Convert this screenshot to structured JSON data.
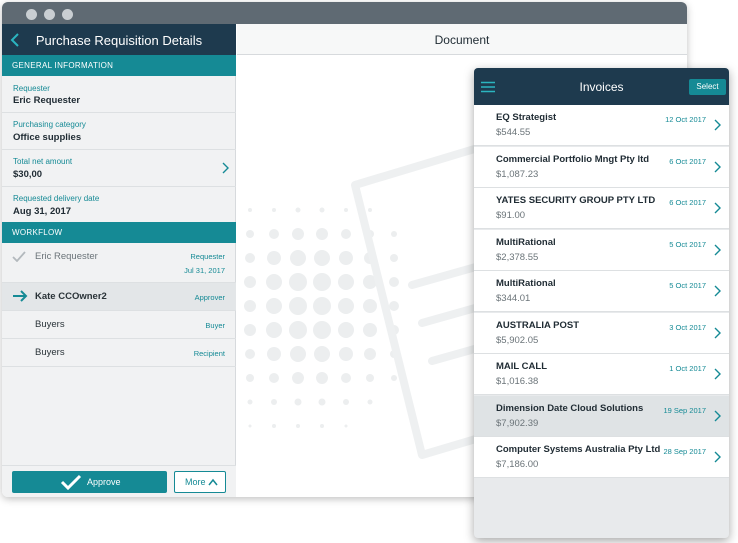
{
  "left_panel": {
    "title": "Purchase Requisition Details",
    "general_section": "General Information",
    "fields": [
      {
        "label": "Requester",
        "value": "Eric Requester"
      },
      {
        "label": "Purchasing category",
        "value": "Office supplies"
      },
      {
        "label": "Total net amount",
        "value": "$30,00"
      },
      {
        "label": "Requested delivery date",
        "value": "Aug 31, 2017"
      }
    ],
    "workflow_section": "Workflow",
    "workflow": [
      {
        "name": "Eric Requester",
        "role": "Requester",
        "date": "Jul 31, 2017",
        "status": "done"
      },
      {
        "name": "Kate CCOwner2",
        "role": "Approver",
        "status": "current"
      },
      {
        "name": "Buyers",
        "role": "Buyer",
        "status": "pending"
      },
      {
        "name": "Buyers",
        "role": "Recipient",
        "status": "pending"
      }
    ],
    "approve_label": "Approve",
    "more_label": "More"
  },
  "document_panel": {
    "title": "Document"
  },
  "invoices_panel": {
    "title": "Invoices",
    "select_label": "Select",
    "items": [
      {
        "name": "EQ Strategist",
        "amount": "$544.55",
        "date": "12 Oct 2017"
      },
      {
        "name": "Commercial Portfolio Mngt Pty ltd",
        "amount": "$1,087.23",
        "date": "6 Oct 2017"
      },
      {
        "name": "YATES SECURITY GROUP PTY LTD",
        "amount": "$91.00",
        "date": "6 Oct 2017"
      },
      {
        "name": "MultiRational",
        "amount": "$2,378.55",
        "date": "5 Oct 2017"
      },
      {
        "name": "MultiRational",
        "amount": "$344.01",
        "date": "5 Oct 2017"
      },
      {
        "name": "AUSTRALIA POST",
        "amount": "$5,902.05",
        "date": "3 Oct 2017"
      },
      {
        "name": "MAIL CALL",
        "amount": "$1,016.38",
        "date": "1 Oct 2017"
      },
      {
        "name": "Dimension Date Cloud Solutions",
        "amount": "$7,902.39",
        "date": "19 Sep 2017",
        "selected": true
      },
      {
        "name": "Computer Systems Australia Pty Ltd",
        "amount": "$7,186.00",
        "date": "28 Sep 2017"
      }
    ]
  },
  "colors": {
    "header_navy": "#1e3a4e",
    "accent_teal": "#158a95",
    "titlebar_gray": "#5f6a73"
  }
}
